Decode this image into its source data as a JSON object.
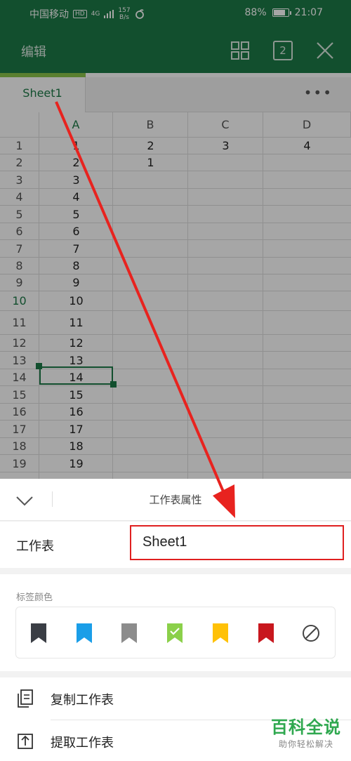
{
  "status_bar": {
    "carrier": "中国移动",
    "hd": "HD",
    "signal": "4G",
    "speed_value": "157",
    "speed_unit": "B/s",
    "battery": "88%",
    "battery_level": 0.88,
    "time": "21:07"
  },
  "app_bar": {
    "title": "编辑",
    "sheet_count": "2"
  },
  "sheet_tabs": {
    "active_tab": "Sheet1",
    "more": "•••"
  },
  "grid": {
    "columns": [
      "A",
      "B",
      "C",
      "D"
    ],
    "active_column": "A",
    "active_row": "10",
    "rows": [
      {
        "num": "1",
        "A": "1",
        "B": "2",
        "C": "3",
        "D": "4"
      },
      {
        "num": "2",
        "A": "2",
        "B": "1",
        "C": "",
        "D": ""
      },
      {
        "num": "3",
        "A": "3",
        "B": "",
        "C": "",
        "D": ""
      },
      {
        "num": "4",
        "A": "4",
        "B": "",
        "C": "",
        "D": ""
      },
      {
        "num": "5",
        "A": "5",
        "B": "",
        "C": "",
        "D": ""
      },
      {
        "num": "6",
        "A": "6",
        "B": "",
        "C": "",
        "D": ""
      },
      {
        "num": "7",
        "A": "7",
        "B": "",
        "C": "",
        "D": ""
      },
      {
        "num": "8",
        "A": "8",
        "B": "",
        "C": "",
        "D": ""
      },
      {
        "num": "9",
        "A": "9",
        "B": "",
        "C": "",
        "D": ""
      },
      {
        "num": "10",
        "A": "10",
        "B": "",
        "C": "",
        "D": ""
      },
      {
        "num": "11",
        "A": "11",
        "B": "",
        "C": "",
        "D": ""
      },
      {
        "num": "12",
        "A": "12",
        "B": "",
        "C": "",
        "D": ""
      },
      {
        "num": "13",
        "A": "13",
        "B": "",
        "C": "",
        "D": ""
      },
      {
        "num": "14",
        "A": "14",
        "B": "",
        "C": "",
        "D": ""
      },
      {
        "num": "15",
        "A": "15",
        "B": "",
        "C": "",
        "D": ""
      },
      {
        "num": "16",
        "A": "16",
        "B": "",
        "C": "",
        "D": ""
      },
      {
        "num": "17",
        "A": "17",
        "B": "",
        "C": "",
        "D": ""
      },
      {
        "num": "18",
        "A": "18",
        "B": "",
        "C": "",
        "D": ""
      },
      {
        "num": "19",
        "A": "19",
        "B": "",
        "C": "",
        "D": ""
      }
    ]
  },
  "panel": {
    "title": "工作表属性",
    "name_label": "工作表",
    "name_value": "Sheet1",
    "color_label": "标签颜色",
    "colors": [
      {
        "name": "dark-gray",
        "hex": "#3a3e45"
      },
      {
        "name": "blue",
        "hex": "#1a9ee8"
      },
      {
        "name": "gray",
        "hex": "#8c8c8c"
      },
      {
        "name": "green-selected",
        "hex": "#8bd04a"
      },
      {
        "name": "yellow",
        "hex": "#ffc107"
      },
      {
        "name": "red",
        "hex": "#c8171e"
      },
      {
        "name": "none",
        "hex": ""
      }
    ],
    "menu": [
      {
        "label": "复制工作表",
        "icon": "copy-sheet-icon"
      },
      {
        "label": "提取工作表",
        "icon": "extract-sheet-icon"
      }
    ]
  },
  "watermark": {
    "main": "百科全说",
    "sub": "助你轻松解决"
  },
  "colors": {
    "brand_green": "#1d7a47",
    "highlight_red": "#e02020"
  }
}
